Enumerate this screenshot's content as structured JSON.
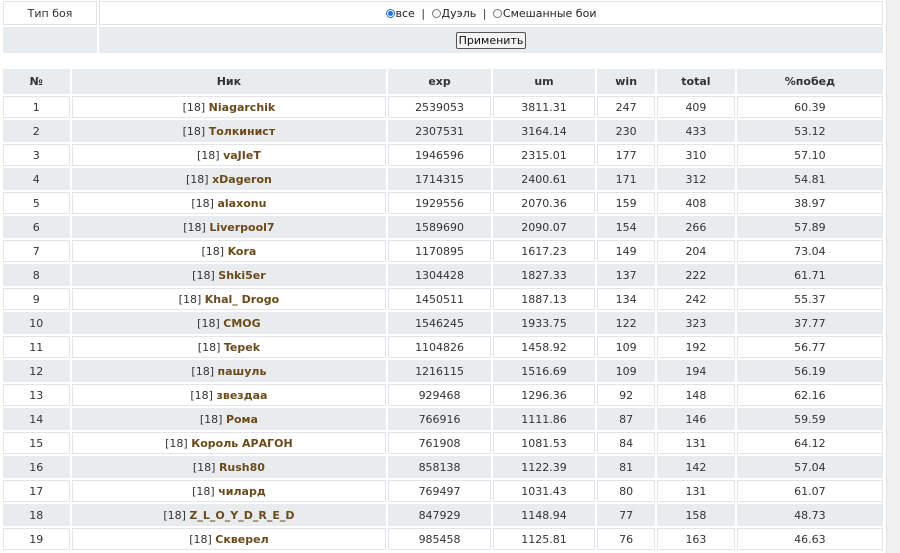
{
  "filter": {
    "label": "Тип боя",
    "options": [
      {
        "label": "все",
        "selected": true
      },
      {
        "label": "Дуэль",
        "selected": false
      },
      {
        "label": "Смешанные бои",
        "selected": false
      }
    ],
    "separator": "|",
    "apply_label": "Применить"
  },
  "table": {
    "headers": [
      "№",
      "Ник",
      "exp",
      "um",
      "win",
      "total",
      "%побед"
    ],
    "rows": [
      {
        "no": "1",
        "level": "[18]",
        "nick": "Niagarchik",
        "exp": "2539053",
        "um": "3811.31",
        "win": "247",
        "total": "409",
        "pct": "60.39"
      },
      {
        "no": "2",
        "level": "[18]",
        "nick": "Толкинист",
        "exp": "2307531",
        "um": "3164.14",
        "win": "230",
        "total": "433",
        "pct": "53.12"
      },
      {
        "no": "3",
        "level": "[18]",
        "nick": "vaJIeT",
        "exp": "1946596",
        "um": "2315.01",
        "win": "177",
        "total": "310",
        "pct": "57.10"
      },
      {
        "no": "4",
        "level": "[18]",
        "nick": "xDageron",
        "exp": "1714315",
        "um": "2400.61",
        "win": "171",
        "total": "312",
        "pct": "54.81"
      },
      {
        "no": "5",
        "level": "[18]",
        "nick": "alaxonu",
        "exp": "1929556",
        "um": "2070.36",
        "win": "159",
        "total": "408",
        "pct": "38.97"
      },
      {
        "no": "6",
        "level": "[18]",
        "nick": "Liverpool7",
        "exp": "1589690",
        "um": "2090.07",
        "win": "154",
        "total": "266",
        "pct": "57.89"
      },
      {
        "no": "7",
        "level": "[18]",
        "nick": "Kora",
        "exp": "1170895",
        "um": "1617.23",
        "win": "149",
        "total": "204",
        "pct": "73.04"
      },
      {
        "no": "8",
        "level": "[18]",
        "nick": "Shki5er",
        "exp": "1304428",
        "um": "1827.33",
        "win": "137",
        "total": "222",
        "pct": "61.71"
      },
      {
        "no": "9",
        "level": "[18]",
        "nick": "Khal_ Drogo",
        "exp": "1450511",
        "um": "1887.13",
        "win": "134",
        "total": "242",
        "pct": "55.37"
      },
      {
        "no": "10",
        "level": "[18]",
        "nick": "CMOG",
        "exp": "1546245",
        "um": "1933.75",
        "win": "122",
        "total": "323",
        "pct": "37.77"
      },
      {
        "no": "11",
        "level": "[18]",
        "nick": "Tepek",
        "exp": "1104826",
        "um": "1458.92",
        "win": "109",
        "total": "192",
        "pct": "56.77"
      },
      {
        "no": "12",
        "level": "[18]",
        "nick": "пашуль",
        "exp": "1216115",
        "um": "1516.69",
        "win": "109",
        "total": "194",
        "pct": "56.19"
      },
      {
        "no": "13",
        "level": "[18]",
        "nick": "звездаа",
        "exp": "929468",
        "um": "1296.36",
        "win": "92",
        "total": "148",
        "pct": "62.16"
      },
      {
        "no": "14",
        "level": "[18]",
        "nick": "Рома",
        "exp": "766916",
        "um": "1111.86",
        "win": "87",
        "total": "146",
        "pct": "59.59"
      },
      {
        "no": "15",
        "level": "[18]",
        "nick": "Король АРАГОН",
        "exp": "761908",
        "um": "1081.53",
        "win": "84",
        "total": "131",
        "pct": "64.12"
      },
      {
        "no": "16",
        "level": "[18]",
        "nick": "Rush80",
        "exp": "858138",
        "um": "1122.39",
        "win": "81",
        "total": "142",
        "pct": "57.04"
      },
      {
        "no": "17",
        "level": "[18]",
        "nick": "чилард",
        "exp": "769497",
        "um": "1031.43",
        "win": "80",
        "total": "131",
        "pct": "61.07"
      },
      {
        "no": "18",
        "level": "[18]",
        "nick": "Z_L_O_Y_D_R_E_D",
        "exp": "847929",
        "um": "1148.94",
        "win": "77",
        "total": "158",
        "pct": "48.73"
      },
      {
        "no": "19",
        "level": "[18]",
        "nick": "Скверел",
        "exp": "985458",
        "um": "1125.81",
        "win": "76",
        "total": "163",
        "pct": "46.63"
      }
    ]
  },
  "colors": {
    "nick": "#6b4a1a",
    "row_alt_bg": "#e9ecef",
    "radio_selected": "#1a73e8"
  }
}
